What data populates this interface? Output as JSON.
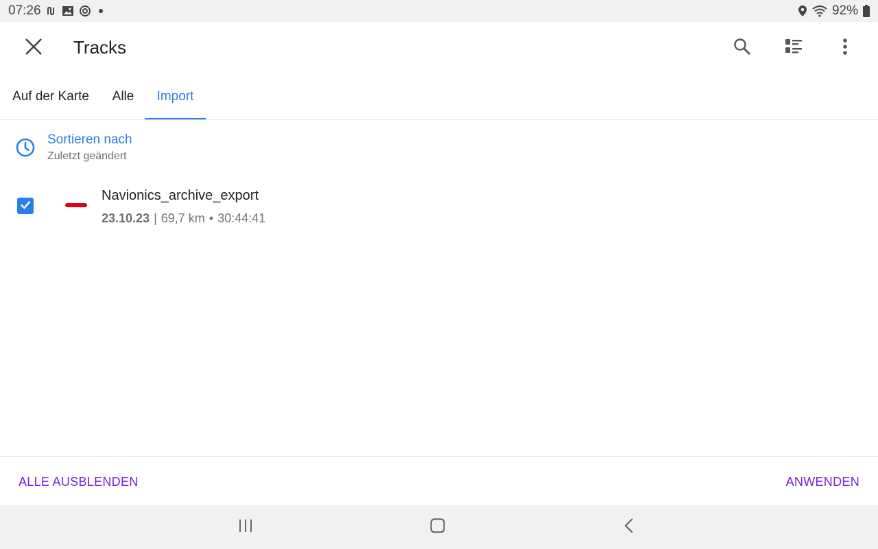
{
  "status_bar": {
    "time": "07:26",
    "battery": "92%",
    "icons": [
      "notification-n-icon",
      "image-icon",
      "sync-icon",
      "more-dot",
      "location-icon",
      "wifi-icon",
      "battery-icon"
    ]
  },
  "app_bar": {
    "title": "Tracks",
    "icons": [
      "close-icon",
      "search-icon",
      "filter-list-icon",
      "more-vert-icon"
    ]
  },
  "tabs": [
    {
      "label": "Auf der Karte",
      "active": false
    },
    {
      "label": "Alle",
      "active": false
    },
    {
      "label": "Import",
      "active": true
    }
  ],
  "sort": {
    "title": "Sortieren nach",
    "value": "Zuletzt geändert",
    "icon": "clock-icon"
  },
  "tracks": [
    {
      "name": "Navionics_archive_export",
      "date": "23.10.23",
      "separator": "|",
      "distance": "69,7 km",
      "bullet": "•",
      "duration": "30:44:41",
      "checked": true,
      "color": "#e0000f"
    }
  ],
  "actions": {
    "hide_all": "ALLE AUSBLENDEN",
    "apply": "ANWENDEN"
  },
  "colors": {
    "accent": "#2b7de9",
    "action": "#7b1fe0"
  },
  "nav_bar": {
    "icons": [
      "recents-icon",
      "home-icon",
      "back-icon"
    ]
  }
}
